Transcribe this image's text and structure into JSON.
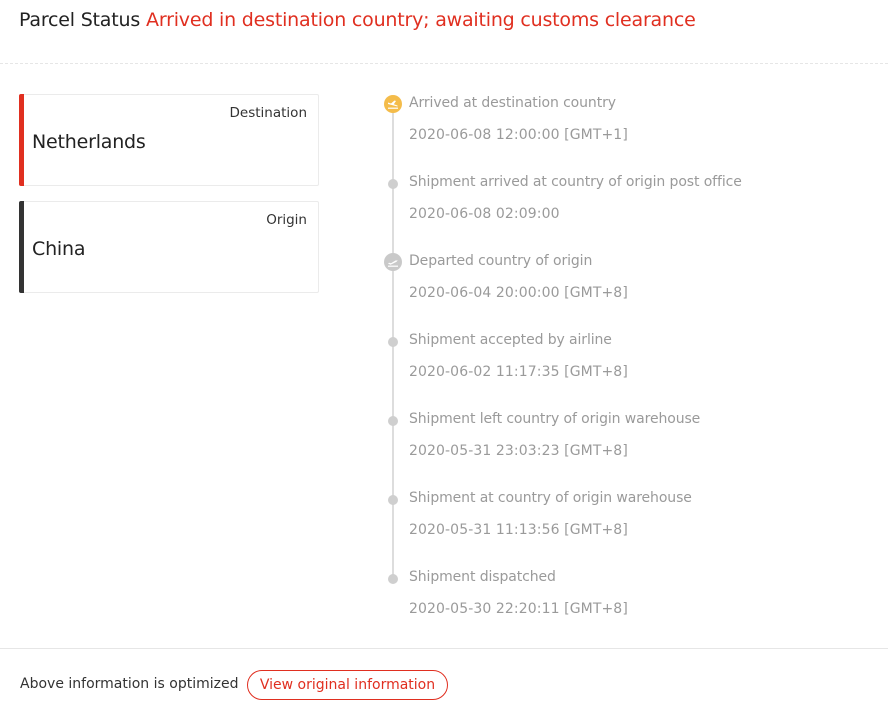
{
  "header": {
    "label": "Parcel Status",
    "status": "Arrived in destination country; awaiting customs clearance"
  },
  "colors": {
    "accent": "#e02f20",
    "origin_bar": "#333333",
    "current_event": "#f4bc4a",
    "past_event": "#c9c9c9",
    "muted_text": "#9a9a9a"
  },
  "cards": {
    "destination": {
      "role": "Destination",
      "country": "Netherlands"
    },
    "origin": {
      "role": "Origin",
      "country": "China"
    }
  },
  "events": [
    {
      "title": "Arrived at destination country",
      "time": "2020-06-08 12:00:00 [GMT+1]",
      "icon": "plane-landing-icon",
      "state": "current"
    },
    {
      "title": "Shipment arrived at country of origin post office",
      "time": "2020-06-08 02:09:00",
      "icon": "dot",
      "state": "past"
    },
    {
      "title": "Departed country of origin",
      "time": "2020-06-04 20:00:00 [GMT+8]",
      "icon": "plane-takeoff-icon",
      "state": "past"
    },
    {
      "title": "Shipment accepted by airline",
      "time": "2020-06-02 11:17:35 [GMT+8]",
      "icon": "dot",
      "state": "past"
    },
    {
      "title": "Shipment left country of origin warehouse",
      "time": "2020-05-31 23:03:23 [GMT+8]",
      "icon": "dot",
      "state": "past"
    },
    {
      "title": "Shipment at country of origin warehouse",
      "time": "2020-05-31 11:13:56 [GMT+8]",
      "icon": "dot",
      "state": "past"
    },
    {
      "title": "Shipment dispatched",
      "time": "2020-05-30 22:20:11 [GMT+8]",
      "icon": "dot",
      "state": "past"
    }
  ],
  "footer": {
    "note": "Above information is optimized",
    "button_label": "View original information"
  }
}
